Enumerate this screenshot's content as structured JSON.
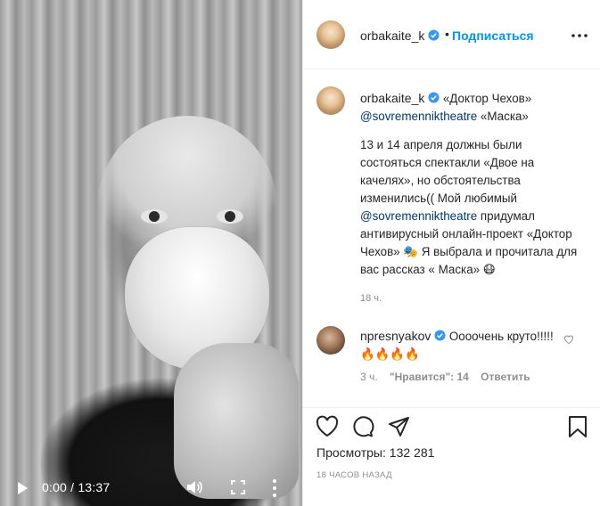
{
  "video": {
    "time": "0:00 / 13:37"
  },
  "post": {
    "author": "orbakaite_k",
    "follow_label": "Подписаться",
    "separator": "•",
    "caption": {
      "author": "orbakaite_k",
      "line1_text": " «Доктор Чехов»",
      "mention1": "@sovremenniktheatre",
      "line1_tail": " «Маска»",
      "para2_a": "13 и 14 апреля должны были состояться спектакли «Двое на качелях», но обстоятельства изменились(( Мой любимый ",
      "mention2": "@sovremenniktheatre",
      "para2_b": " придумал антивирусный онлайн-проект «Доктор Чехов» 🎭 Я выбрала и прочитала для вас рассказ « Маска» 😷",
      "time": "18 ч."
    },
    "comment": {
      "author": "npresnyakov",
      "text": " Оооочень круто!!!!! 🔥🔥🔥🔥",
      "time": "3 ч.",
      "likes": "\"Нравится\": 14",
      "reply": "Ответить"
    },
    "views_label": "Просмотры:",
    "views_count": "132 281",
    "posted_ago": "18 ЧАСОВ НАЗАД"
  },
  "colors": {
    "link": "#00376b",
    "follow": "#0095f6",
    "verified": "#3897f0",
    "muted": "#8e8e8e"
  }
}
